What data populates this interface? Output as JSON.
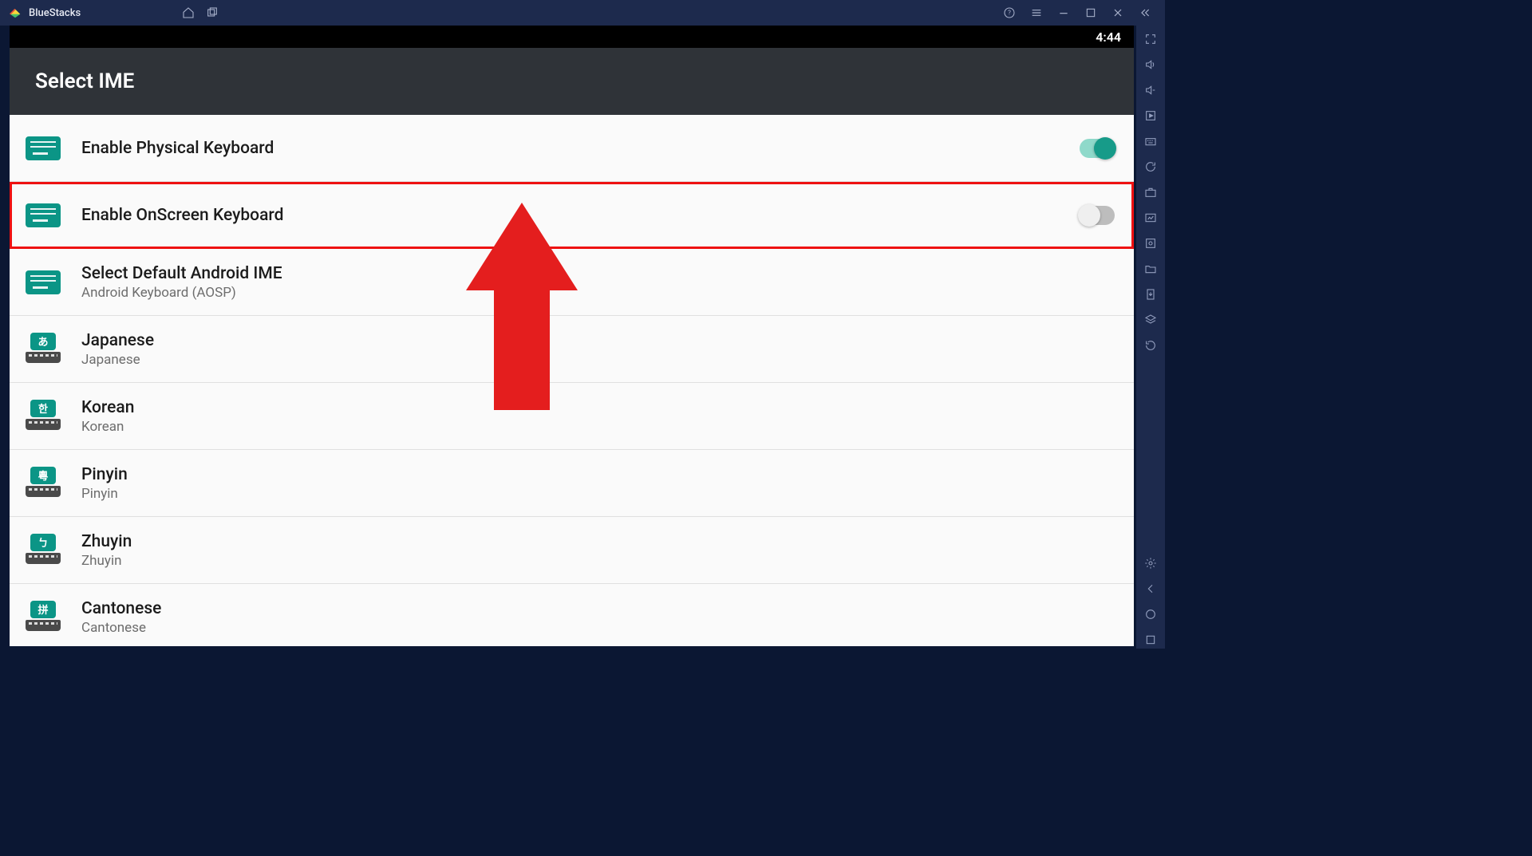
{
  "titlebar": {
    "app_name": "BlueStacks",
    "icons": {
      "home": "home-icon",
      "windows": "multi-window-icon",
      "help": "help-icon",
      "menu": "hamburger-icon",
      "min": "minimize-icon",
      "max": "maximize-icon",
      "close": "close-icon",
      "collapse": "chevrons-left-icon"
    }
  },
  "sidebar_icons": [
    "fullscreen-icon",
    "volume-up-icon",
    "volume-down-icon",
    "play-square-icon",
    "keyboard-map-icon",
    "refresh-icon",
    "briefcase-icon",
    "image-adjust-icon",
    "screenshot-icon",
    "folder-icon",
    "install-apk-icon",
    "layers-icon",
    "rotate-icon"
  ],
  "sidebar_bottom": [
    "settings-gear-icon",
    "back-icon",
    "home-circle-icon",
    "recents-icon"
  ],
  "statusbar": {
    "time": "4:44"
  },
  "page": {
    "title": "Select IME",
    "rows": [
      {
        "id": "enable-physical",
        "icon_type": "green",
        "primary": "Enable Physical Keyboard",
        "secondary": "",
        "toggle": "on",
        "highlight": false
      },
      {
        "id": "enable-onscreen",
        "icon_type": "green",
        "primary": "Enable OnScreen Keyboard",
        "secondary": "",
        "toggle": "off",
        "highlight": true
      },
      {
        "id": "default-ime",
        "icon_type": "green",
        "primary": "Select Default Android IME",
        "secondary": "Android Keyboard (AOSP)",
        "toggle": "",
        "highlight": false
      },
      {
        "id": "japanese",
        "icon_type": "dark",
        "badge": "あ",
        "primary": "Japanese",
        "secondary": "Japanese",
        "toggle": "",
        "highlight": false
      },
      {
        "id": "korean",
        "icon_type": "dark",
        "badge": "한",
        "primary": "Korean",
        "secondary": "Korean",
        "toggle": "",
        "highlight": false
      },
      {
        "id": "pinyin",
        "icon_type": "dark",
        "badge": "粵",
        "primary": "Pinyin",
        "secondary": "Pinyin",
        "toggle": "",
        "highlight": false
      },
      {
        "id": "zhuyin",
        "icon_type": "dark",
        "badge": "ㄅ",
        "primary": "Zhuyin",
        "secondary": "Zhuyin",
        "toggle": "",
        "highlight": false
      },
      {
        "id": "cantonese",
        "icon_type": "dark",
        "badge": "拼",
        "primary": "Cantonese",
        "secondary": "Cantonese",
        "toggle": "",
        "highlight": false
      }
    ]
  },
  "annotation": {
    "arrow_color": "#e41e1e"
  }
}
